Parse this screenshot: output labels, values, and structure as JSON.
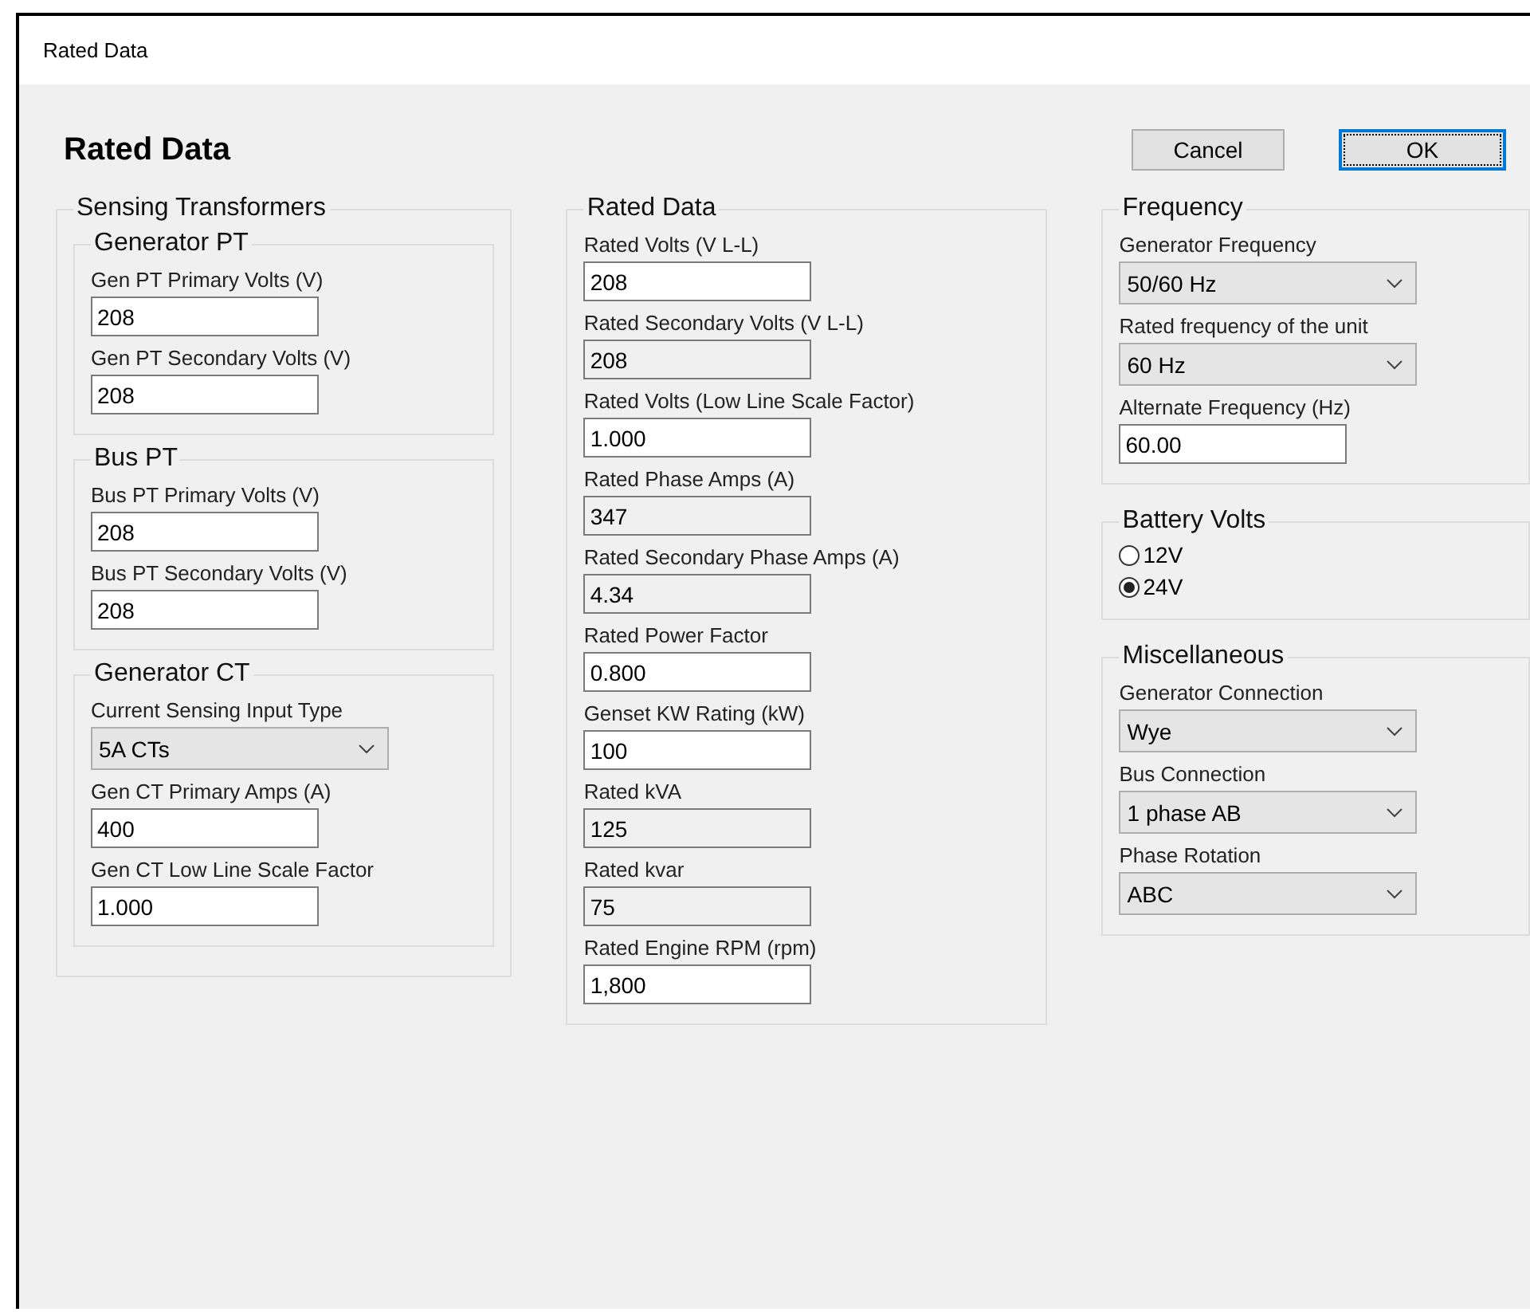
{
  "window": {
    "title": "Rated Data"
  },
  "heading": "Rated Data",
  "buttons": [
    {
      "label": "Cancel",
      "focused": false
    },
    {
      "label": "OK",
      "focused": true
    }
  ],
  "columns": [
    [
      {
        "title": "Sensing Transformers",
        "groups": [
          {
            "title": "Generator PT",
            "fields": [
              {
                "kind": "text",
                "label": "Gen PT Primary Volts (V)",
                "value": "208"
              },
              {
                "kind": "text",
                "label": "Gen PT Secondary Volts (V)",
                "value": "208"
              }
            ]
          },
          {
            "title": "Bus PT",
            "fields": [
              {
                "kind": "text",
                "label": "Bus PT Primary Volts (V)",
                "value": "208"
              },
              {
                "kind": "text",
                "label": "Bus PT Secondary Volts (V)",
                "value": "208"
              }
            ]
          },
          {
            "title": "Generator CT",
            "fields": [
              {
                "kind": "dropdown",
                "label": "Current Sensing Input Type",
                "value": "5A CTs"
              },
              {
                "kind": "text",
                "label": "Gen CT Primary Amps (A)",
                "value": "400"
              },
              {
                "kind": "text",
                "label": "Gen CT Low Line Scale Factor",
                "value": "1.000"
              }
            ]
          }
        ]
      }
    ],
    [
      {
        "title": "Rated Data",
        "fields": [
          {
            "kind": "text",
            "label": "Rated Volts (V L-L)",
            "value": "208"
          },
          {
            "kind": "readonly",
            "label": "Rated Secondary Volts (V L-L)",
            "value": "208"
          },
          {
            "kind": "text",
            "label": "Rated Volts (Low Line Scale Factor)",
            "value": "1.000"
          },
          {
            "kind": "readonly",
            "label": "Rated Phase Amps (A)",
            "value": "347"
          },
          {
            "kind": "readonly",
            "label": "Rated Secondary Phase Amps (A)",
            "value": "4.34"
          },
          {
            "kind": "text",
            "label": "Rated Power Factor",
            "value": "0.800"
          },
          {
            "kind": "text",
            "label": "Genset KW Rating (kW)",
            "value": "100"
          },
          {
            "kind": "readonly",
            "label": "Rated kVA",
            "value": "125"
          },
          {
            "kind": "readonly",
            "label": "Rated kvar",
            "value": "75"
          },
          {
            "kind": "text",
            "label": "Rated Engine RPM (rpm)",
            "value": "1,800"
          }
        ]
      }
    ],
    [
      {
        "title": "Frequency",
        "fields": [
          {
            "kind": "dropdown",
            "label": "Generator Frequency",
            "value": "50/60 Hz"
          },
          {
            "kind": "dropdown",
            "label": "Rated frequency of the unit",
            "value": "60 Hz"
          },
          {
            "kind": "text",
            "label": "Alternate Frequency (Hz)",
            "value": "60.00"
          }
        ]
      },
      {
        "title": "Battery Volts",
        "fields": [
          {
            "kind": "radio",
            "options": [
              {
                "label": "12V",
                "selected": false
              },
              {
                "label": "24V",
                "selected": true
              }
            ]
          }
        ]
      },
      {
        "title": "Miscellaneous",
        "fields": [
          {
            "kind": "dropdown",
            "label": "Generator Connection",
            "value": "Wye"
          },
          {
            "kind": "dropdown",
            "label": "Bus Connection",
            "value": "1 phase AB"
          },
          {
            "kind": "dropdown",
            "label": "Phase Rotation",
            "value": "ABC"
          }
        ]
      }
    ]
  ]
}
